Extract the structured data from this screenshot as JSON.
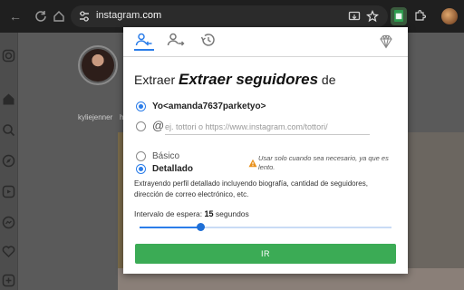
{
  "browser": {
    "url_prefix": "instagram",
    "url_suffix": ".com"
  },
  "instagram": {
    "story_user": "kyliejenner",
    "story_user_partial": "h"
  },
  "extension": {
    "title_prefix": "Extraer",
    "title_main": "Extraer seguidores",
    "title_suffix": "de",
    "source_options": {
      "self_label": "Yo<amanda7637parketyo>",
      "self_selected": true,
      "url_at": "@",
      "url_placeholder": "ej. tottori o https://www.instagram.com/tottori/",
      "url_value": ""
    },
    "mode_options": {
      "basic_label": "Básico",
      "detailed_label": "Detallado",
      "selected": "detailed",
      "warning": "Usar solo cuando sea necesario, ya que es lento."
    },
    "description": "Extrayendo perfil detallado incluyendo biografía, cantidad de seguidores, dirección de correo electrónico, etc.",
    "interval": {
      "label": "Intervalo de espera:",
      "value": "15",
      "unit": "segundos",
      "slider_fraction": 0.24
    },
    "submit_label": "IR",
    "colors": {
      "accent": "#2b7de9",
      "submit": "#3bab55",
      "warning": "#e8911d"
    }
  }
}
